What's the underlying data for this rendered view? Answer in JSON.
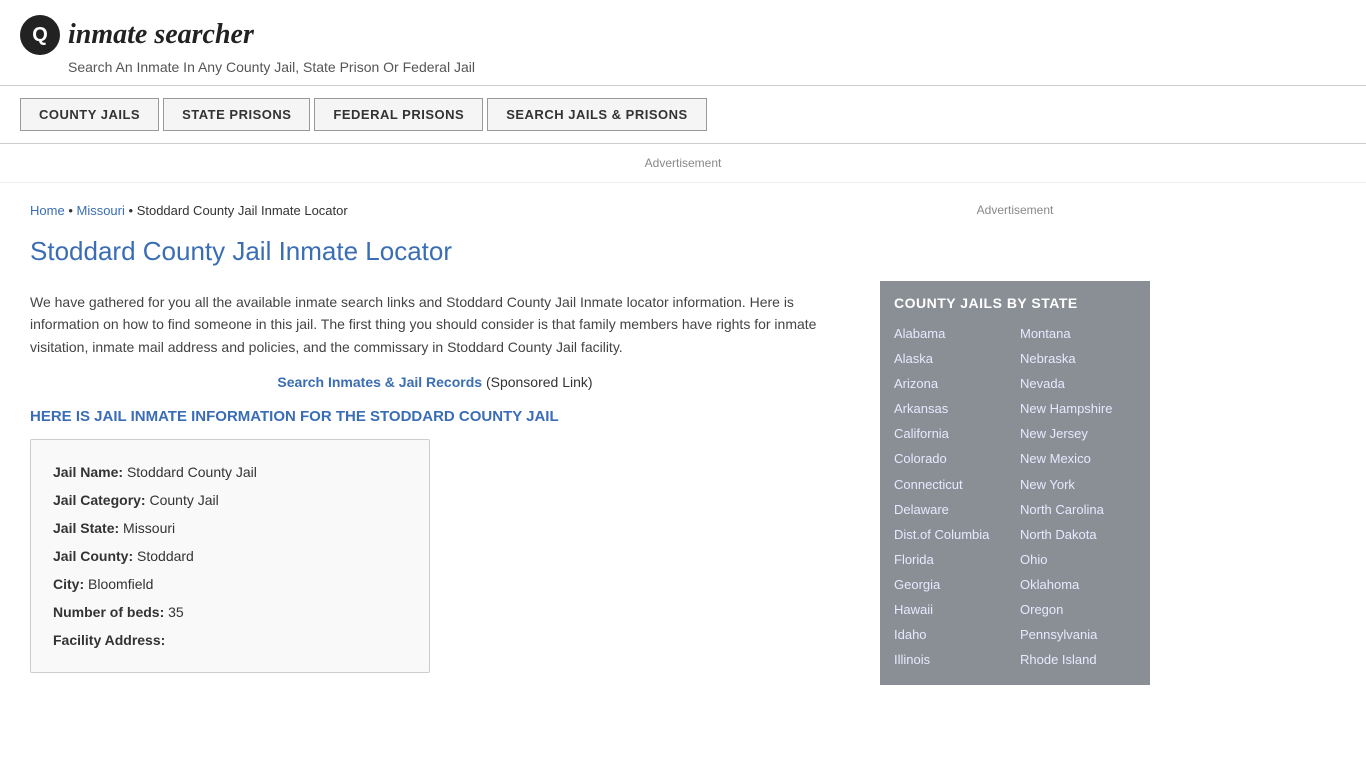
{
  "header": {
    "logo_icon": "🔍",
    "logo_text": "inmate searcher",
    "tagline": "Search An Inmate In Any County Jail, State Prison Or Federal Jail"
  },
  "nav": {
    "items": [
      {
        "label": "COUNTY JAILS",
        "id": "county-jails"
      },
      {
        "label": "STATE PRISONS",
        "id": "state-prisons"
      },
      {
        "label": "FEDERAL PRISONS",
        "id": "federal-prisons"
      },
      {
        "label": "SEARCH JAILS & PRISONS",
        "id": "search-jails-prisons"
      }
    ]
  },
  "ad_label": "Advertisement",
  "breadcrumb": {
    "home": "Home",
    "state": "Missouri",
    "current": "Stoddard County Jail Inmate Locator"
  },
  "page": {
    "title": "Stoddard County Jail Inmate Locator",
    "description": "We have gathered for you all the available inmate search links and Stoddard County Jail Inmate locator information. Here is information on how to find someone in this jail. The first thing you should consider is that family members have rights for inmate visitation, inmate mail address and policies, and the commissary in Stoddard County Jail facility.",
    "sponsored_text": "Search Inmates & Jail Records",
    "sponsored_suffix": "(Sponsored Link)",
    "section_heading": "HERE IS JAIL INMATE INFORMATION FOR THE STODDARD COUNTY JAIL"
  },
  "jail_info": {
    "name_label": "Jail Name:",
    "name_value": "Stoddard County Jail",
    "category_label": "Jail Category:",
    "category_value": "County Jail",
    "state_label": "Jail State:",
    "state_value": "Missouri",
    "county_label": "Jail County:",
    "county_value": "Stoddard",
    "city_label": "City:",
    "city_value": "Bloomfield",
    "beds_label": "Number of beds:",
    "beds_value": "35",
    "address_label": "Facility Address:"
  },
  "sidebar": {
    "ad_label": "Advertisement",
    "state_box_title": "COUNTY JAILS BY STATE",
    "states_col1": [
      "Alabama",
      "Alaska",
      "Arizona",
      "Arkansas",
      "California",
      "Colorado",
      "Connecticut",
      "Delaware",
      "Dist.of Columbia",
      "Florida",
      "Georgia",
      "Hawaii",
      "Idaho",
      "Illinois"
    ],
    "states_col2": [
      "Montana",
      "Nebraska",
      "Nevada",
      "New Hampshire",
      "New Jersey",
      "New Mexico",
      "New York",
      "North Carolina",
      "North Dakota",
      "Ohio",
      "Oklahoma",
      "Oregon",
      "Pennsylvania",
      "Rhode Island"
    ]
  }
}
